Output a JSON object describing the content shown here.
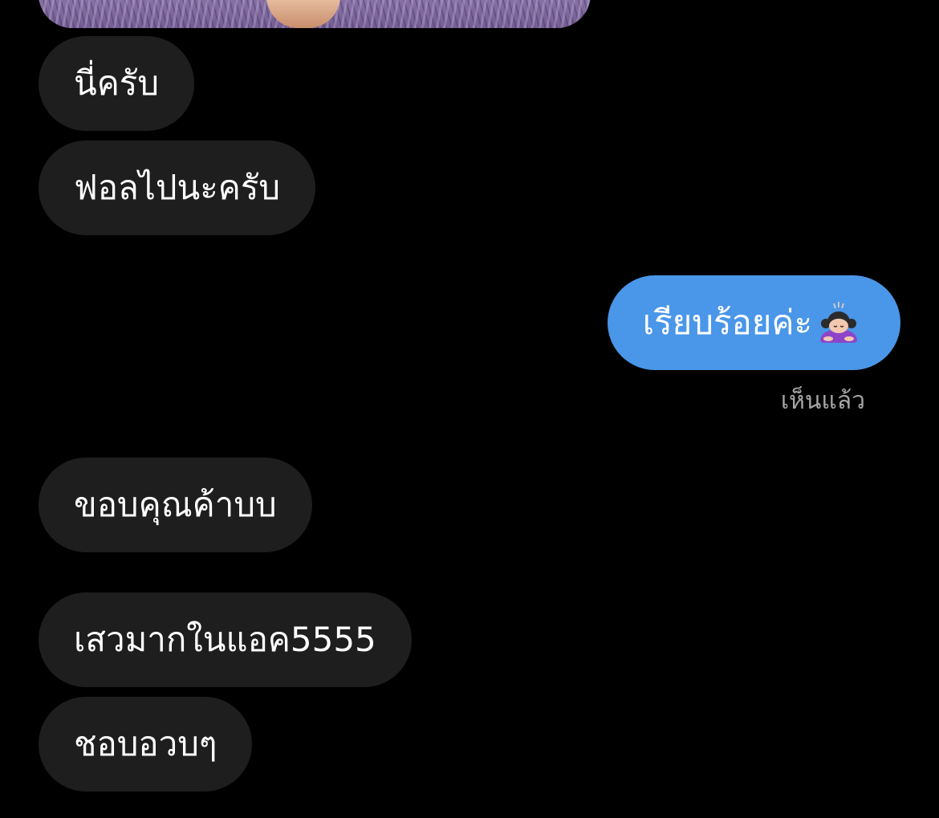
{
  "conversation": {
    "image_message": {
      "description_icon": "photo-lavender-field"
    },
    "messages": [
      {
        "direction": "received",
        "text": "นี่ครับ"
      },
      {
        "direction": "received",
        "text": "ฟอลไปนะครับ"
      },
      {
        "direction": "sent",
        "text": "เรียบร้อยค่ะ",
        "emoji": "person-bowing-emoji"
      },
      {
        "direction": "received",
        "text": "ขอบคุณค้าบบ"
      },
      {
        "direction": "received",
        "text": "เสวมากในแอค5555"
      },
      {
        "direction": "received",
        "text": "ชอบอวบๆ"
      }
    ],
    "seen_label": "เห็นแล้ว"
  },
  "colors": {
    "background": "#000000",
    "received_bubble": "#1e1e1e",
    "sent_bubble": "#4a96e8",
    "seen_text": "#a6a6a6"
  }
}
